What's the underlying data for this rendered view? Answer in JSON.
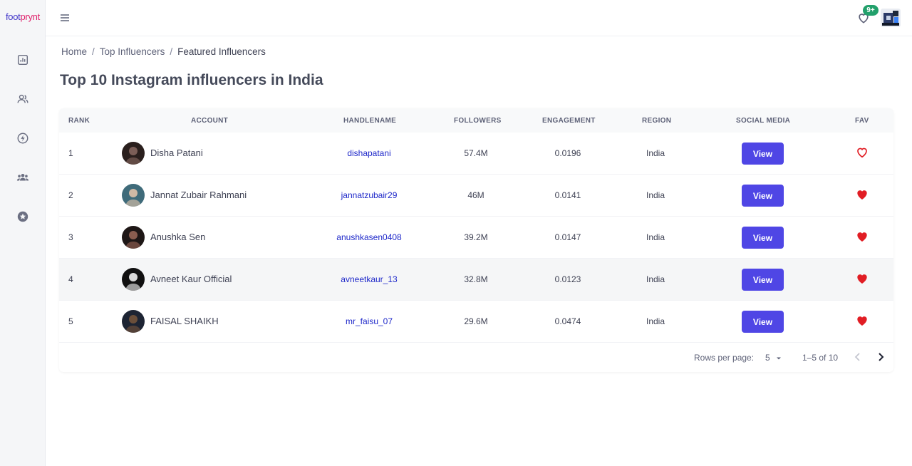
{
  "brand": {
    "logo_part1": "foot",
    "logo_part2": "prynt"
  },
  "topbar": {
    "notification_count": "9+"
  },
  "breadcrumb": {
    "home": "Home",
    "sep": "/",
    "top_influencers": "Top Influencers",
    "current": "Featured Influencers"
  },
  "page_title": "Top 10 Instagram influencers in India",
  "table": {
    "columns": [
      "RANK",
      "ACCOUNT",
      "HANDLENAME",
      "FOLLOWERS",
      "ENGAGEMENT",
      "REGION",
      "SOCIAL MEDIA",
      "FAV"
    ],
    "rows": [
      {
        "rank": "1",
        "account": "Disha Patani",
        "handle": "dishapatani",
        "followers": "57.4M",
        "engagement": "0.0196",
        "region": "India",
        "social": "View",
        "fav": false
      },
      {
        "rank": "2",
        "account": "Jannat Zubair Rahmani",
        "handle": "jannatzubair29",
        "followers": "46M",
        "engagement": "0.0141",
        "region": "India",
        "social": "View",
        "fav": true
      },
      {
        "rank": "3",
        "account": "Anushka Sen",
        "handle": "anushkasen0408",
        "followers": "39.2M",
        "engagement": "0.0147",
        "region": "India",
        "social": "View",
        "fav": true
      },
      {
        "rank": "4",
        "account": "Avneet Kaur Official",
        "handle": "avneetkaur_13",
        "followers": "32.8M",
        "engagement": "0.0123",
        "region": "India",
        "social": "View",
        "fav": true
      },
      {
        "rank": "5",
        "account": "FAISAL SHAIKH",
        "handle": "mr_faisu_07",
        "followers": "29.6M",
        "engagement": "0.0474",
        "region": "India",
        "social": "View",
        "fav": true
      }
    ]
  },
  "pagination": {
    "rows_label": "Rows per page:",
    "rows_value": "5",
    "range": "1–5 of 10"
  },
  "colors": {
    "accent": "#4f46e5",
    "link": "#1d27c9",
    "fav": "#e11d24",
    "badge": "#22a06b"
  },
  "icons": {
    "sidebar": [
      "chart-icon",
      "users-icon",
      "lightning-icon",
      "group-icon",
      "star-icon"
    ],
    "topbar": [
      "menu-icon",
      "heart-icon"
    ]
  }
}
